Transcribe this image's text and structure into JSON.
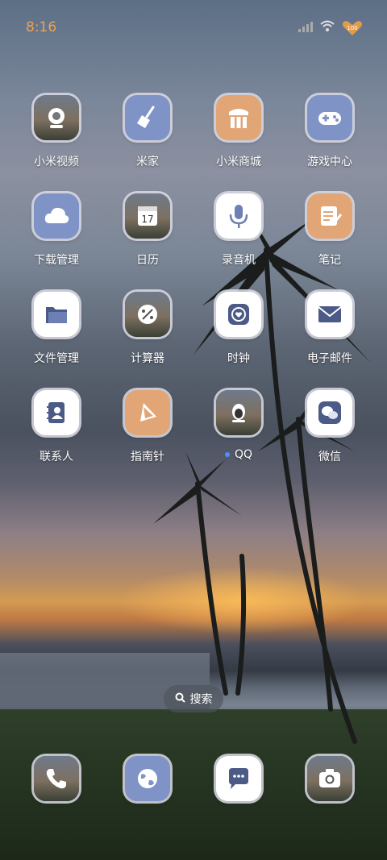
{
  "status_bar": {
    "time": "8:16",
    "battery": "100"
  },
  "apps": [
    {
      "label": "小米视频",
      "icon": "video-camera-icon"
    },
    {
      "label": "米家",
      "icon": "broom-icon"
    },
    {
      "label": "小米商城",
      "icon": "store-icon"
    },
    {
      "label": "游戏中心",
      "icon": "gamepad-icon"
    },
    {
      "label": "下载管理",
      "icon": "cloud-icon"
    },
    {
      "label": "日历",
      "icon": "calendar-icon",
      "date": "17"
    },
    {
      "label": "录音机",
      "icon": "microphone-icon"
    },
    {
      "label": "笔记",
      "icon": "notes-icon"
    },
    {
      "label": "文件管理",
      "icon": "folder-icon"
    },
    {
      "label": "计算器",
      "icon": "calculator-icon"
    },
    {
      "label": "时钟",
      "icon": "clock-icon"
    },
    {
      "label": "电子邮件",
      "icon": "mail-icon"
    },
    {
      "label": "联系人",
      "icon": "contacts-icon"
    },
    {
      "label": "指南针",
      "icon": "compass-icon"
    },
    {
      "label": "QQ",
      "icon": "qq-penguin-icon"
    },
    {
      "label": "微信",
      "icon": "wechat-icon"
    }
  ],
  "search": {
    "label": "搜索"
  },
  "dock": [
    {
      "icon": "phone-icon"
    },
    {
      "icon": "browser-globe-icon"
    },
    {
      "icon": "messages-icon"
    },
    {
      "icon": "camera-icon"
    }
  ]
}
